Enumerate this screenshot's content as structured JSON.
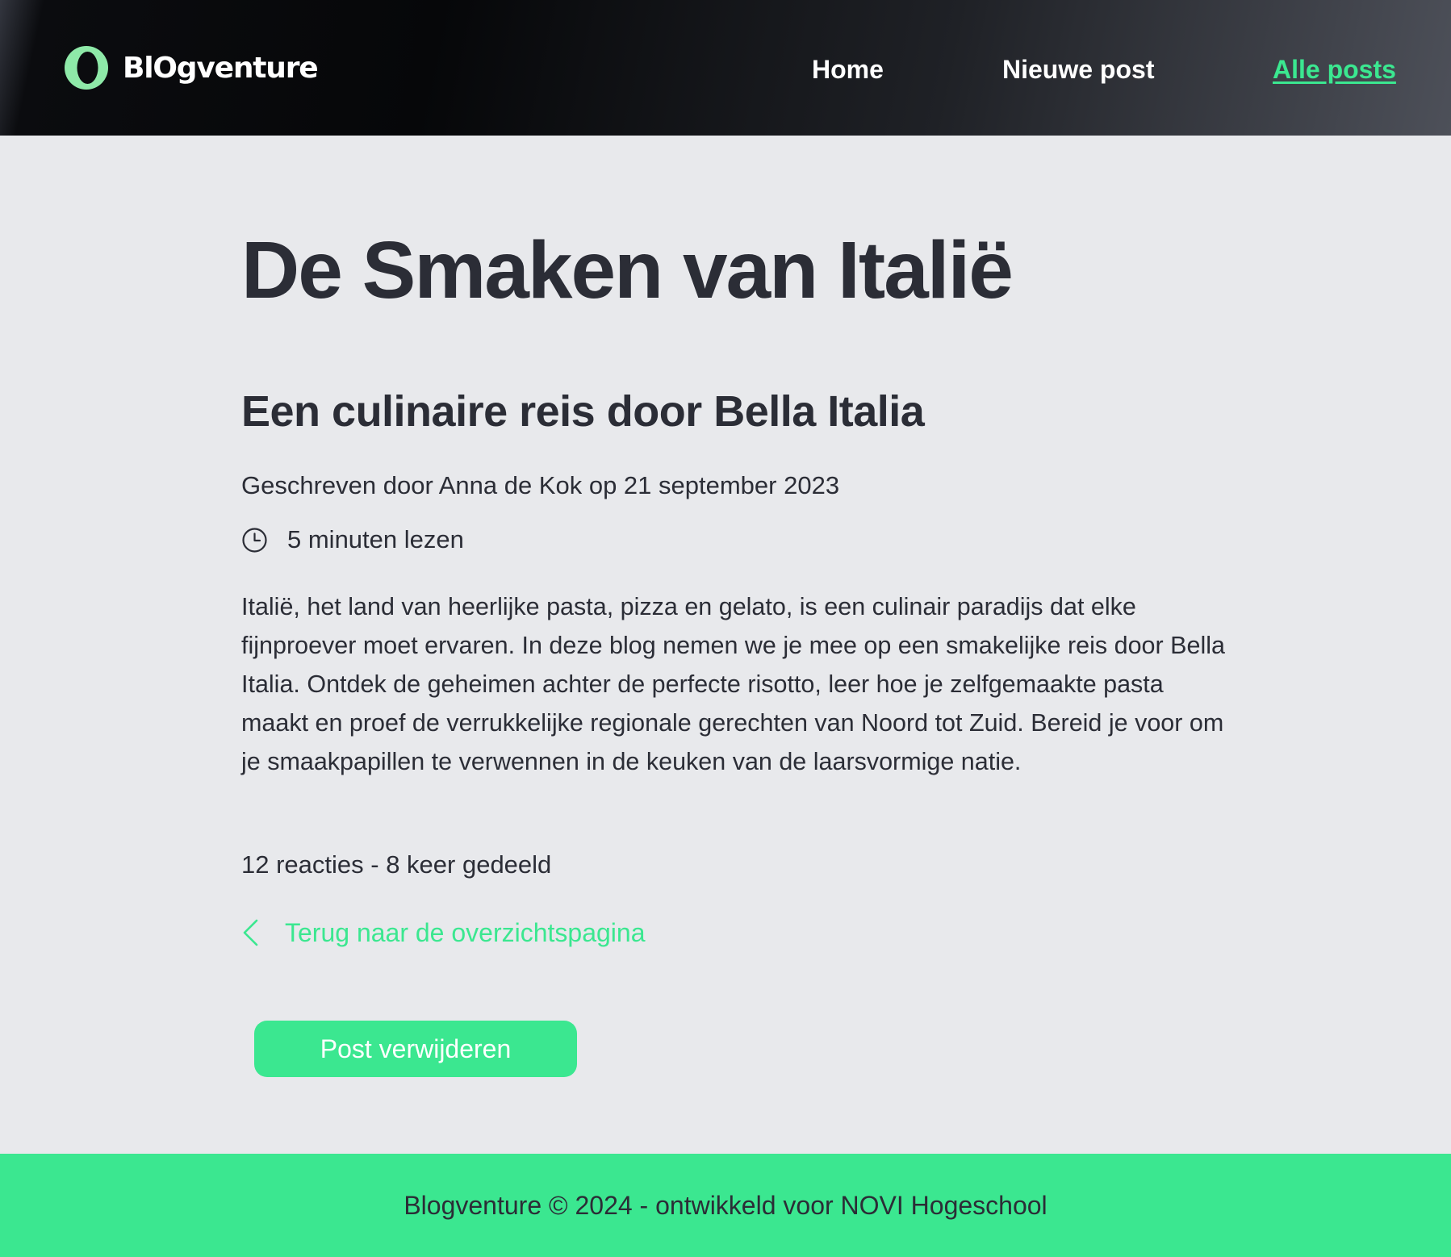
{
  "brand": {
    "logo_text": "BlOgventure",
    "accent_color": "#3be790",
    "text_color": "#2b2d36"
  },
  "nav": {
    "items": [
      {
        "label": "Home",
        "active": false
      },
      {
        "label": "Nieuwe post",
        "active": false
      },
      {
        "label": "Alle posts",
        "active": true
      }
    ]
  },
  "post": {
    "title": "De Smaken van Italië",
    "subtitle": "Een culinaire reis door Bella Italia",
    "byline": "Geschreven door Anna de Kok op 21 september 2023",
    "read_time": "5 minuten lezen",
    "body": "Italië, het land van heerlijke pasta, pizza en gelato, is een culinair paradijs dat elke fijnproever moet ervaren. In deze blog nemen we je mee op een smakelijke reis door Bella Italia. Ontdek de geheimen achter de perfecte risotto, leer hoe je zelfgemaakte pasta maakt en proef de verrukkelijke regionale gerechten van Noord tot Zuid. Bereid je voor om je smaakpapillen te verwennen in de keuken van de laarsvormige natie.",
    "stats": "12 reacties - 8 keer gedeeld"
  },
  "actions": {
    "back_label": "Terug naar de overzichtspagina",
    "delete_label": "Post verwijderen"
  },
  "footer": {
    "text": "Blogventure © 2024 - ontwikkeld voor NOVI Hogeschool"
  },
  "icons": {
    "logo": "logo-icon",
    "clock": "clock-icon",
    "back": "chevron-left-icon"
  }
}
